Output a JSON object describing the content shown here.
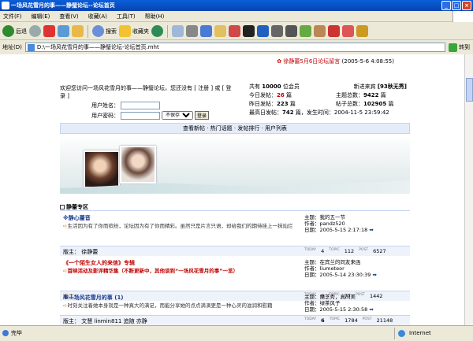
{
  "window": {
    "title": "一场风花雪月的事——静璧论坛--论坛首页"
  },
  "menu": [
    "文件(F)",
    "编辑(E)",
    "查看(V)",
    "收藏(A)",
    "工具(T)",
    "帮助(H)"
  ],
  "toolbar": {
    "back_label": "后退",
    "search_label": "搜索",
    "favorites_label": "收藏夹"
  },
  "address": {
    "label": "地址(D)",
    "url": "D:\\一场风花雪月的事——静璧论坛-论坛首页.mht",
    "go_label": "转到"
  },
  "status": {
    "text": "完毕",
    "zone": "Internet"
  },
  "forum": {
    "announcement": {
      "link": "徐静蕾5月6日论坛留言",
      "time": "(2005-5-6 4:08:55)"
    },
    "login": {
      "welcome": "欢迎您访问一场风花雪月的事——静璧论坛，您还没有 [ 注册 ] 或 [ 登录 ]",
      "username_label": "用户姓名：",
      "password_label": "用户密码：",
      "save_option": "不保存",
      "submit_label": "登录"
    },
    "stats": {
      "total_prefix": "共有",
      "total_users": "10000",
      "total_suffix": "位会员",
      "newest_label": "新进来宾",
      "newest_user": "[93秋无秀]",
      "today_label": "今日发帖：",
      "today_value": "26",
      "today_unit": "篇",
      "topics_label": "主题总数：",
      "topics_value": "9422",
      "topics_unit": "篇",
      "yesterday_label": "昨日发帖：",
      "yesterday_value": "223",
      "yesterday_unit": "篇",
      "posts_label": "帖子总数：",
      "posts_value": "102905",
      "posts_unit": "篇",
      "peak_label": "最高日发帖：",
      "peak_value": "742",
      "peak_rest": "篇，发生时间：2004-11-5 23:59:42"
    },
    "nav": [
      "查看新帖",
      "热门话题",
      "发帖排行",
      "用户列表"
    ],
    "section_title": "静蕾专区",
    "boards": [
      {
        "title": "※静心蕾音",
        "desc": "生活因为有了你而缤纷，论坛因为有了你而精彩。虽然只是片言只语，却给我们的期待挂上一抹灿烂",
        "mods_label": "版主：",
        "mods": "徐静蕾",
        "last_topic": "主题：我的五一节",
        "last_author": "作者：pandz520",
        "last_date": "日期：2005-5-15 2:17:18",
        "today": "4",
        "topics": "112",
        "posts": "6527"
      },
      {
        "title": "《一个陌生女人的来信》专辑",
        "desc": "首映活动及影评精华集（不断更新中，其他谈到“一场风花雪月的事”一览）",
        "mods_label": "版主：",
        "mods": "",
        "last_topic": "主题：在宾兰的同友来函",
        "last_author": "作者：liumeteor",
        "last_date": "日期：2005-5-14 23:30:39",
        "today": "0",
        "topics": "77",
        "posts": "1442"
      },
      {
        "title": "※一场风花雪月的事 (1)",
        "desc": "时刻关注着她本身就是一种真大的满足，而能分享她的点点滴滴更是一种心灵的滋润和慰藉",
        "mods_label": "版主：",
        "mods": "文慧  linmin811  追随  亦静",
        "last_topic": "主题：丽芝秀，真的美",
        "last_author": "作者：绿茶风子",
        "last_date": "日期：2005-5-15 2:30:58",
        "today": "6",
        "topics": "1784",
        "posts": "21148"
      }
    ],
    "count_labels": {
      "today": "TODAY",
      "topic": "TOPIC",
      "post": "POST"
    }
  }
}
